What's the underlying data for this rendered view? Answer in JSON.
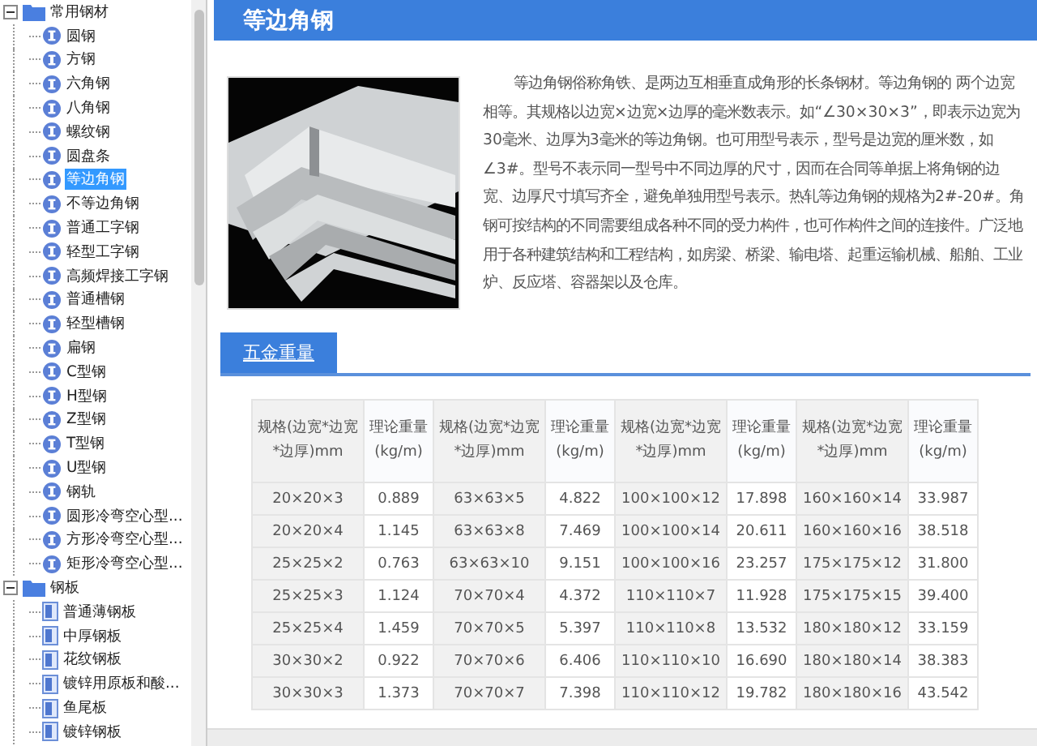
{
  "sidebar": {
    "tree": [
      {
        "label": "常用钢材",
        "expanded": true,
        "selected": false,
        "children": [
          {
            "label": "圆钢",
            "kind": "circle",
            "selected": false
          },
          {
            "label": "方钢",
            "kind": "circle",
            "selected": false
          },
          {
            "label": "六角钢",
            "kind": "circle",
            "selected": false
          },
          {
            "label": "八角钢",
            "kind": "circle",
            "selected": false
          },
          {
            "label": "螺纹钢",
            "kind": "circle",
            "selected": false
          },
          {
            "label": "圆盘条",
            "kind": "circle",
            "selected": false
          },
          {
            "label": "等边角钢",
            "kind": "circle",
            "selected": true
          },
          {
            "label": "不等边角钢",
            "kind": "circle",
            "selected": false
          },
          {
            "label": "普通工字钢",
            "kind": "circle",
            "selected": false
          },
          {
            "label": "轻型工字钢",
            "kind": "circle",
            "selected": false
          },
          {
            "label": "高频焊接工字钢",
            "kind": "circle",
            "selected": false
          },
          {
            "label": "普通槽钢",
            "kind": "circle",
            "selected": false
          },
          {
            "label": "轻型槽钢",
            "kind": "circle",
            "selected": false
          },
          {
            "label": "扁钢",
            "kind": "circle",
            "selected": false
          },
          {
            "label": "C型钢",
            "kind": "circle",
            "selected": false
          },
          {
            "label": "H型钢",
            "kind": "circle",
            "selected": false
          },
          {
            "label": "Z型钢",
            "kind": "circle",
            "selected": false
          },
          {
            "label": "T型钢",
            "kind": "circle",
            "selected": false
          },
          {
            "label": "U型钢",
            "kind": "circle",
            "selected": false
          },
          {
            "label": "钢轨",
            "kind": "circle",
            "selected": false
          },
          {
            "label": "圆形冷弯空心型...",
            "kind": "circle",
            "selected": false
          },
          {
            "label": "方形冷弯空心型...",
            "kind": "circle",
            "selected": false
          },
          {
            "label": "矩形冷弯空心型...",
            "kind": "circle",
            "selected": false
          }
        ]
      },
      {
        "label": "钢板",
        "expanded": true,
        "selected": false,
        "children": [
          {
            "label": "普通薄钢板",
            "kind": "sheet",
            "selected": false
          },
          {
            "label": "中厚钢板",
            "kind": "sheet",
            "selected": false
          },
          {
            "label": "花纹钢板",
            "kind": "sheet",
            "selected": false
          },
          {
            "label": "镀锌用原板和酸...",
            "kind": "sheet",
            "selected": false
          },
          {
            "label": "鱼尾板",
            "kind": "sheet",
            "selected": false
          },
          {
            "label": "镀锌钢板",
            "kind": "sheet",
            "selected": false
          }
        ]
      }
    ]
  },
  "page": {
    "title": "等边角钢",
    "description": "等边角钢俗称角铁、是两边互相垂直成角形的长条钢材。等边角钢的 两个边宽相等。其规格以边宽×边宽×边厚的毫米数表示。如“∠30×30×3”，即表示边宽为 30毫米、边厚为3毫米的等边角钢。也可用型号表示，型号是边宽的厘米数，如∠3#。型号不表示同一型号中不同边厚的尺寸，因而在合同等单据上将角钢的边宽、边厚尺寸填写齐全，避免单独用型号表示。热轧等边角钢的规格为2#-20#。角钢可按结构的不同需要组成各种不同的受力构件，也可作构件之间的连接件。广泛地用于各种建筑结构和工程结构，如房梁、桥梁、输电塔、起重运输机械、船舶、工业炉、反应塔、容器架以及仓库。",
    "tabs": [
      {
        "label": "五金重量",
        "selected": true
      }
    ],
    "table": {
      "columns": [
        "规格(边宽*边宽*边厚)mm",
        "理论重量(kg/m)",
        "规格(边宽*边宽*边厚)mm",
        "理论重量(kg/m)",
        "规格(边宽*边宽*边厚)mm",
        "理论重量(kg/m)",
        "规格(边宽*边宽*边厚)mm",
        "理论重量(kg/m)"
      ],
      "rows": [
        [
          "20×20×3",
          "0.889",
          "63×63×5",
          "4.822",
          "100×100×12",
          "17.898",
          "160×160×14",
          "33.987"
        ],
        [
          "20×20×4",
          "1.145",
          "63×63×8",
          "7.469",
          "100×100×14",
          "20.611",
          "160×160×16",
          "38.518"
        ],
        [
          "25×25×2",
          "0.763",
          "63×63×10",
          "9.151",
          "100×100×16",
          "23.257",
          "175×175×12",
          "31.800"
        ],
        [
          "25×25×3",
          "1.124",
          "70×70×4",
          "4.372",
          "110×110×7",
          "11.928",
          "175×175×15",
          "39.400"
        ],
        [
          "25×25×4",
          "1.459",
          "70×70×5",
          "5.397",
          "110×110×8",
          "13.532",
          "180×180×12",
          "33.159"
        ],
        [
          "30×30×2",
          "0.922",
          "70×70×6",
          "6.406",
          "110×110×10",
          "16.690",
          "180×180×14",
          "38.383"
        ],
        [
          "30×30×3",
          "1.373",
          "70×70×7",
          "7.398",
          "110×110×12",
          "19.782",
          "180×180×16",
          "43.542"
        ]
      ]
    }
  }
}
